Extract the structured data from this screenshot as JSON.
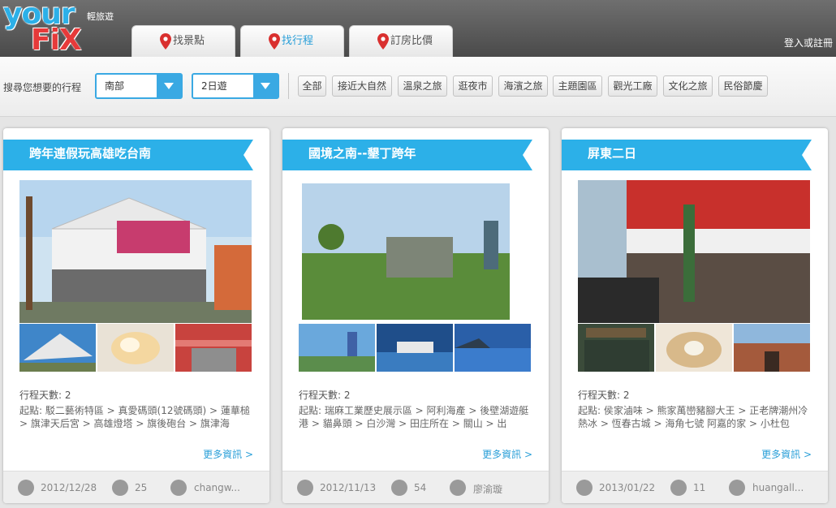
{
  "brand": {
    "logo_line1": "your",
    "logo_line2": "FiX",
    "sub": "輕旅遊"
  },
  "nav": {
    "tabs": [
      {
        "label": "找景點",
        "active": false
      },
      {
        "label": "找行程",
        "active": true
      },
      {
        "label": "訂房比價",
        "active": false
      }
    ],
    "login": "登入或註冊"
  },
  "filter": {
    "label": "搜尋您想要的行程",
    "region": "南部",
    "duration": "2日遊",
    "categories": [
      "全部",
      "接近大自然",
      "溫泉之旅",
      "逛夜市",
      "海濱之旅",
      "主題園區",
      "觀光工廠",
      "文化之旅",
      "民俗節慶"
    ]
  },
  "colors": {
    "accent": "#2cb0e8",
    "brand_red": "#e63a3a",
    "link": "#2a9fd8"
  },
  "cards": [
    {
      "title": "跨年連假玩高雄吃台南",
      "days": "行程天數: 2",
      "route": "起點: 駁二藝術特區 > 真愛碼頭(12號碼頭) > 蓮華槌 > 旗津天后宮 > 高雄燈塔 > 旗後砲台 > 旗津海",
      "more": "更多資訊 >",
      "date": "2012/12/28",
      "downloads": "25",
      "author": "changw..."
    },
    {
      "title": "國境之南--墾丁跨年",
      "days": "行程天數: 2",
      "route": "起點: 瑞麻工業歷史展示區 > 阿利海產 > 後壁湖遊艇港 > 貓鼻頭 > 白沙灣 > 田庄所在 > 關山 > 出",
      "more": "更多資訊 >",
      "date": "2012/11/13",
      "downloads": "54",
      "author": "廖渝璇"
    },
    {
      "title": "屏東二日",
      "days": "行程天數: 2",
      "route": "起點: 侯家滷味 > 熊家萬巒豬腳大王 > 正老牌潮州冷熱冰 > 恆春古城 > 海角七號 阿嘉的家 > 小杜包",
      "more": "更多資訊 >",
      "date": "2013/01/22",
      "downloads": "11",
      "author": "huangall..."
    }
  ]
}
